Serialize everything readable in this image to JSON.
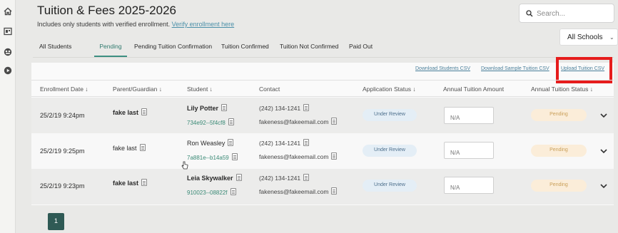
{
  "nav": {
    "icons": [
      "home-icon",
      "dashboard-icon",
      "users-icon",
      "play-icon"
    ]
  },
  "header": {
    "title": "Tuition & Fees 2025-2026",
    "subtitle": "Includes only students with verified enrollment.",
    "subtitle_link": "Verify enrollment here"
  },
  "search": {
    "placeholder": "Search..."
  },
  "school_filter": {
    "selected": "All Schools"
  },
  "tabs": [
    {
      "label": "All Students"
    },
    {
      "label": "Pending",
      "active": true
    },
    {
      "label": "Pending Tuition Confirmation"
    },
    {
      "label": "Tuition Confirmed"
    },
    {
      "label": "Tuition Not Confirmed"
    },
    {
      "label": "Paid Out"
    }
  ],
  "actions": {
    "download_students": "Download Students CSV",
    "download_sample": "Download Sample Tuition CSV",
    "upload": "Upload Tuition CSV"
  },
  "table": {
    "columns": [
      "Enrollment Date ↓",
      "Parent/Guardian ↓",
      "Student ↓",
      "Contact",
      "Application Status ↓",
      "Annual Tuition Amount",
      "Annual Tuition Status ↓"
    ],
    "rows": [
      {
        "date": "25/2/19 9:24pm",
        "parent": "fake last",
        "student": "Lily Potter",
        "student_id": "734e92--5f4cf8",
        "phone": "(242) 134-1241",
        "email": "fakeness@fakeemail.com",
        "app_status": "Under Review",
        "amount_placeholder": "N/A",
        "tuition_status": "Pending"
      },
      {
        "date": "25/2/19 9:25pm",
        "parent": "fake last",
        "student": "Ron Weasley",
        "student_id": "7a881e--b14a59",
        "phone": "(242) 134-1241",
        "email": "fakeness@fakeemail.com",
        "app_status": "Under Review",
        "amount_placeholder": "N/A",
        "tuition_status": "Pending"
      },
      {
        "date": "25/2/19 9:23pm",
        "parent": "fake last",
        "student": "Leia Skywalker",
        "student_id": "910023--08822f",
        "phone": "(242) 134-1241",
        "email": "fakeness@fakeemail.com",
        "app_status": "Under Review",
        "amount_placeholder": "N/A",
        "tuition_status": "Pending"
      }
    ]
  },
  "pagination": {
    "current": "1"
  },
  "colors": {
    "accent": "#3d8f82",
    "link": "#4a7f9a",
    "highlight": "#e61c1c",
    "review_pill": "#e4eef6",
    "pending_pill": "#fbedd9"
  }
}
